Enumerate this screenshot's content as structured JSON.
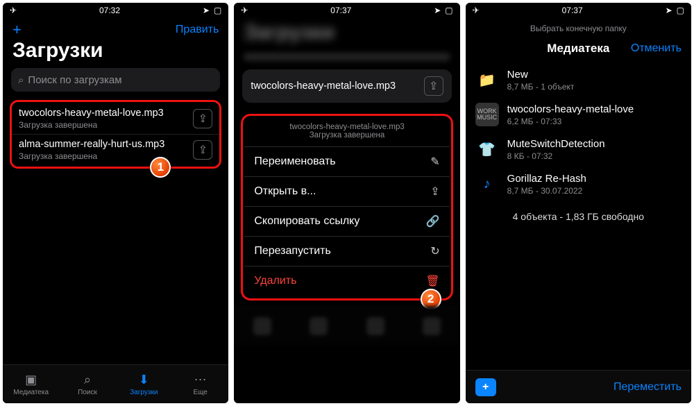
{
  "status": {
    "time1": "07:32",
    "time2": "07:37",
    "time3": "07:37"
  },
  "p1": {
    "edit": "Править",
    "title": "Загрузки",
    "search_placeholder": "Поиск по загрузкам",
    "items": [
      {
        "name": "twocolors-heavy-metal-love.mp3",
        "status": "Загрузка завершена"
      },
      {
        "name": "alma-summer-really-hurt-us.mp3",
        "status": "Загрузка завершена"
      }
    ],
    "badge": "1",
    "tabs": {
      "lib": "Медиатека",
      "search": "Поиск",
      "dl": "Загрузки",
      "more": "Еще"
    }
  },
  "p2": {
    "card_name": "twocolors-heavy-metal-love.mp3",
    "ctx_header_name": "twocolors-heavy-metal-love.mp3",
    "ctx_header_status": "Загрузка завершена",
    "menu": {
      "rename": "Переименовать",
      "open": "Открыть в...",
      "copy": "Скопировать ссылку",
      "restart": "Перезапустить",
      "delete": "Удалить"
    },
    "badge": "2"
  },
  "p3": {
    "picker_hint": "Выбрать конечную папку",
    "picker_title": "Медиатека",
    "cancel": "Отменить",
    "items": [
      {
        "title": "New",
        "sub": "8,7 МБ - 1 объект",
        "icon": "folder"
      },
      {
        "title": "twocolors-heavy-metal-love",
        "sub": "6,2 МБ - 07:33",
        "icon": "gray"
      },
      {
        "title": "MuteSwitchDetection",
        "sub": "8 КБ - 07:32",
        "icon": "shirt"
      },
      {
        "title": "Gorillaz Re-Hash",
        "sub": "8,7 МБ - 30.07.2022",
        "icon": "note"
      }
    ],
    "summary": "4 объекта  -  1,83 ГБ свободно",
    "move": "Переместить"
  }
}
